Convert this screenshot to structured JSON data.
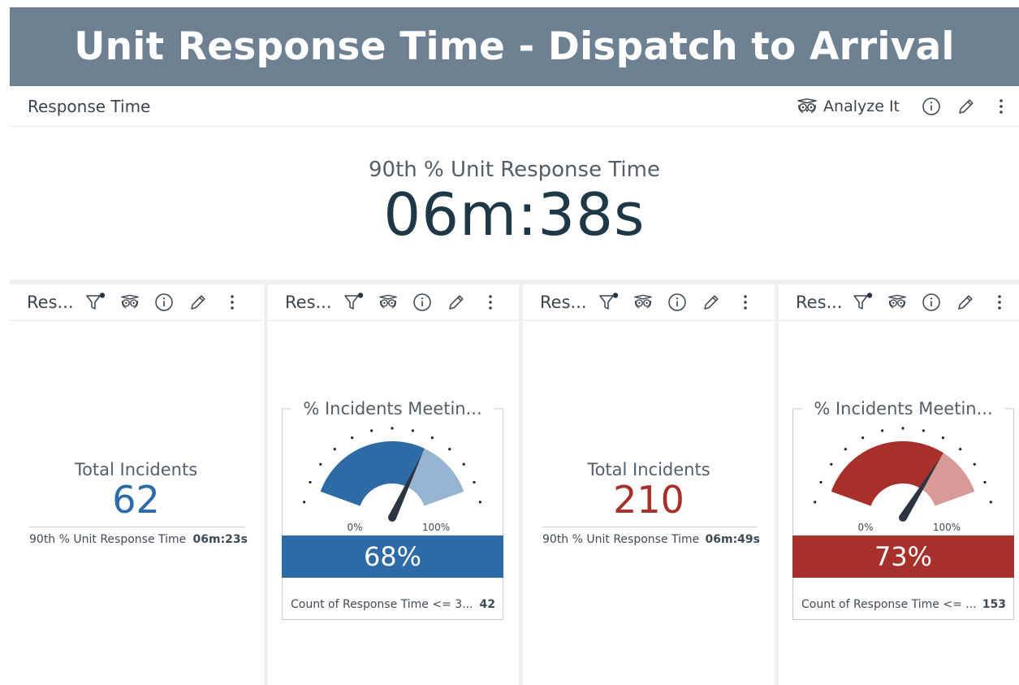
{
  "banner": {
    "title": "Unit Response Time - Dispatch to Arrival"
  },
  "main_widget": {
    "title": "Response Time",
    "analyze_label": "Analyze It",
    "kpi_label": "90th % Unit Response Time",
    "kpi_value": "06m:38s"
  },
  "panels": [
    {
      "title": "Res...",
      "kind": "stat",
      "stat_label": "Total Incidents",
      "stat_value": "62",
      "value_color": "#2e6aa6",
      "foot_label": "90th % Unit Response Time",
      "foot_value": "06m:23s"
    },
    {
      "title": "Res...",
      "kind": "gauge",
      "gauge_title": "% Incidents Meetin...",
      "percent": 68,
      "percent_label": "68%",
      "min_label": "0%",
      "max_label": "100%",
      "color": "#2e6aa6",
      "light_color": "#97b5d3",
      "foot_label": "Count of Response Time <= 3...",
      "foot_value": "42"
    },
    {
      "title": "Res...",
      "kind": "stat",
      "stat_label": "Total Incidents",
      "stat_value": "210",
      "value_color": "#a8302a",
      "foot_label": "90th % Unit Response Time",
      "foot_value": "06m:49s"
    },
    {
      "title": "Res...",
      "kind": "gauge",
      "gauge_title": "% Incidents Meetin...",
      "percent": 73,
      "percent_label": "73%",
      "min_label": "0%",
      "max_label": "100%",
      "color": "#a8302a",
      "light_color": "#d79a97",
      "foot_label": "Count of Response Time <= ...",
      "foot_value": "153"
    }
  ],
  "icons": {
    "filter": "filter-icon",
    "analyze": "owl-icon",
    "info": "info-icon",
    "edit": "pencil-icon",
    "more": "more-vertical-icon"
  }
}
